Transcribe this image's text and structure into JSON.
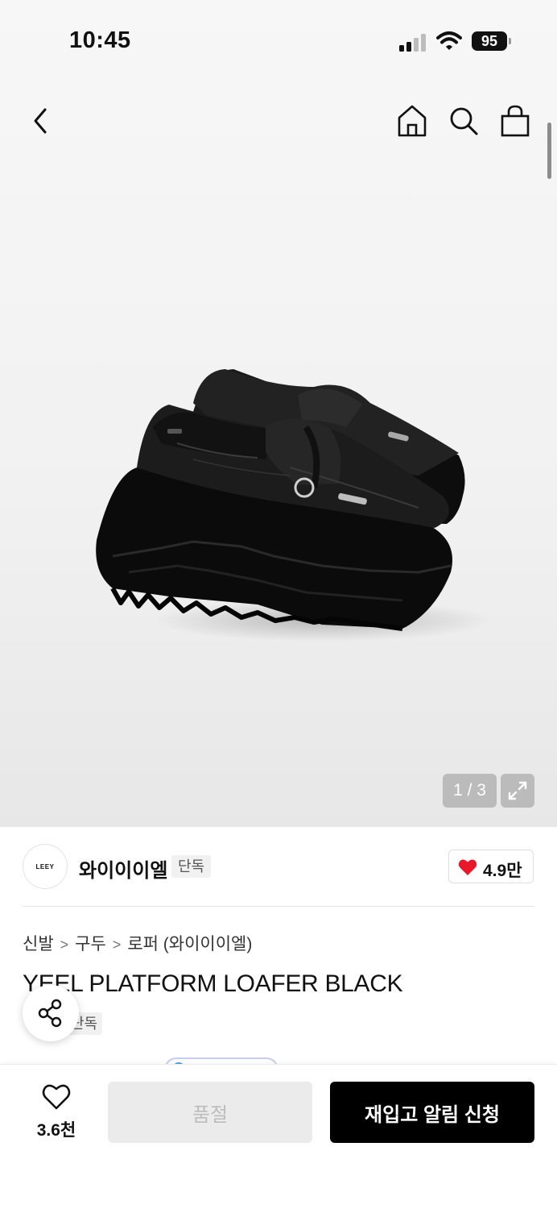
{
  "status_bar": {
    "time": "10:45",
    "battery": "95"
  },
  "nav": {
    "back_icon": "chevron-left-icon",
    "home_icon": "home-icon",
    "search_icon": "search-icon",
    "bag_icon": "shopping-bag-icon"
  },
  "gallery": {
    "counter": "1 / 3",
    "expand_icon": "expand-icon"
  },
  "brand": {
    "logo_text": "LEEY",
    "name": "와이이이엘",
    "badge": "단독",
    "likes": "4.9만",
    "heart_color": "#e8182a"
  },
  "breadcrumb": [
    "신발",
    "구두",
    "로퍼 (와이이이엘)"
  ],
  "product": {
    "title": "YEEL PLATFORM LOAFER BLACK",
    "badge": "단독"
  },
  "bottom": {
    "wish_count": "3.6천",
    "soldout_label": "품절",
    "restock_label": "재입고 알림 신청"
  }
}
